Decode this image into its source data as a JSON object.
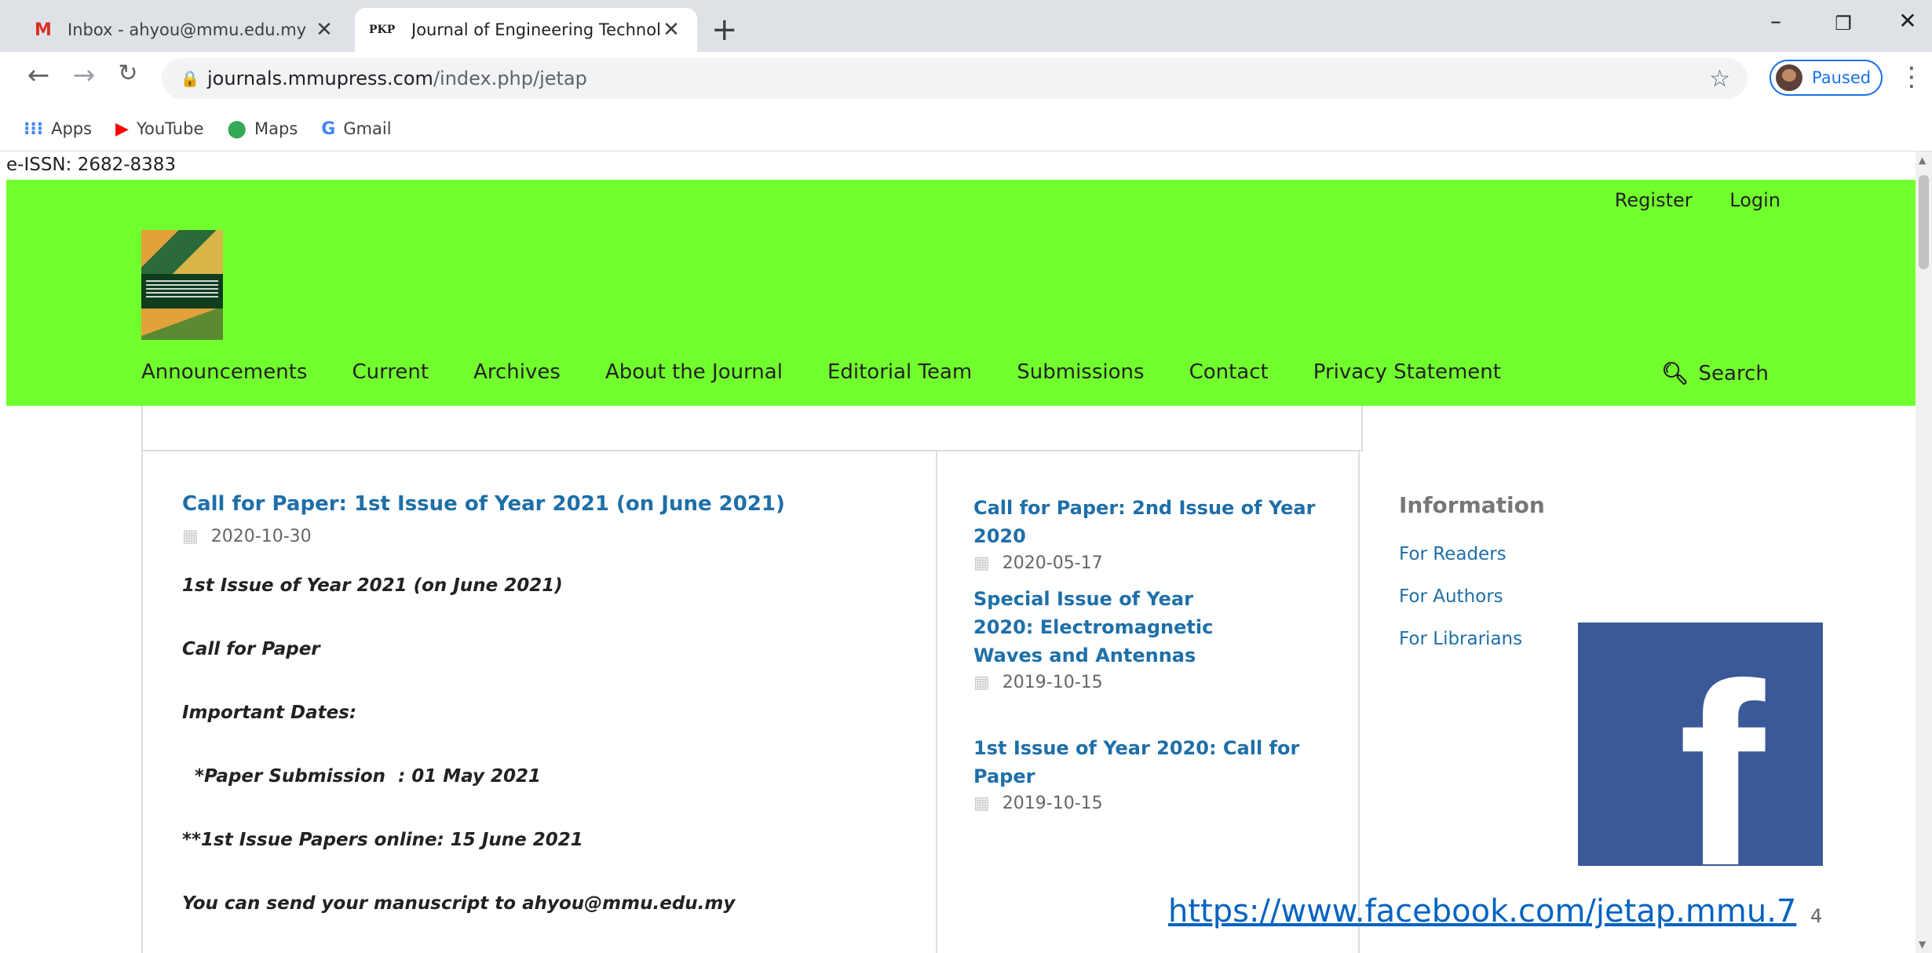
{
  "tabs": [
    {
      "favicon": "M",
      "title": "Inbox - ahyou@mmu.edu.my - M"
    },
    {
      "favicon": "PKP",
      "title": "Journal of Engineering Technolog"
    }
  ],
  "toolbar": {
    "url_host": "journals.mmupress.com",
    "url_path": "/index.php/jetap",
    "profile_label": "Paused"
  },
  "bookmarks": [
    {
      "icon": "apps-icon",
      "label": "Apps"
    },
    {
      "icon": "youtube-icon",
      "label": "YouTube"
    },
    {
      "icon": "maps-icon",
      "label": "Maps"
    },
    {
      "icon": "gmail-icon",
      "label": "Gmail"
    }
  ],
  "page": {
    "issn": "e-ISSN: 2682-8383",
    "user_links": {
      "register": "Register",
      "login": "Login"
    },
    "nav": [
      "Announcements",
      "Current",
      "Archives",
      "About the Journal",
      "Editorial Team",
      "Submissions",
      "Contact",
      "Privacy Statement"
    ],
    "search_label": "Search",
    "announcement": {
      "title": "Call for Paper: 1st Issue of Year 2021 (on June 2021)",
      "date": "2020-10-30",
      "lines": [
        "1st Issue of Year 2021 (on June 2021)",
        "Call for Paper",
        "Important Dates:",
        "  *Paper Submission  : 01 May 2021",
        "**1st Issue Papers online: 15 June 2021",
        "You can send your manuscript to ahyou@mmu.edu.my"
      ]
    },
    "side_announcements": [
      {
        "title": "Call for Paper: 2nd Issue of Year 2020",
        "date": "2020-05-17"
      },
      {
        "title": "Special Issue of Year 2020: Electromagnetic Waves and Antennas",
        "date": "2019-10-15"
      },
      {
        "title": "1st Issue of Year 2020: Call for Paper",
        "date": "2019-10-15"
      }
    ],
    "information": {
      "heading": "Information",
      "links": [
        "For Readers",
        "For Authors",
        "For Librarians"
      ]
    },
    "facebook_url": "https://www.facebook.com/jetap.mmu.7",
    "slide_number": "4"
  },
  "colors": {
    "header_bg": "#72ff2e",
    "link": "#1e6fa8",
    "facebook": "#3b5998"
  }
}
